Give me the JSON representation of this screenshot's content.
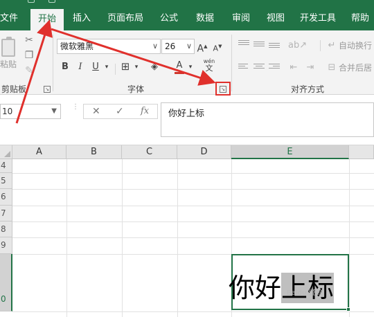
{
  "ribbon": {
    "tabs": [
      {
        "label": "文件"
      },
      {
        "label": "开始",
        "active": true
      },
      {
        "label": "插入"
      },
      {
        "label": "页面布局"
      },
      {
        "label": "公式"
      },
      {
        "label": "数据"
      },
      {
        "label": "审阅"
      },
      {
        "label": "视图"
      },
      {
        "label": "开发工具"
      },
      {
        "label": "帮助"
      }
    ],
    "clipboard": {
      "paste_label": "粘贴",
      "group_label": "剪贴板"
    },
    "font": {
      "font_name": "微软雅黑",
      "font_size": "26",
      "grow_label": "A",
      "shrink_label": "A",
      "bold_label": "B",
      "italic_label": "I",
      "underline_label": "U",
      "font_color_label": "A",
      "phonetic_label": "wén",
      "group_label": "字体"
    },
    "alignment": {
      "wrap_text_label": "自动换行",
      "merge_center_label": "合并后居",
      "group_label": "对齐方式"
    }
  },
  "formula_bar": {
    "name_box": "10",
    "cancel_symbol": "✕",
    "enter_symbol": "✓",
    "fx_symbol": "fx",
    "content": "你好上标"
  },
  "sheet": {
    "columns": [
      "A",
      "B",
      "C",
      "D",
      "E"
    ],
    "rows": [
      "4",
      "5",
      "6",
      "7",
      "8",
      "9",
      "0"
    ],
    "selected_column": "E",
    "active_cell_text_plain": "你好",
    "active_cell_text_selected": "上标",
    "watermark": "Baidu 经验"
  },
  "colors": {
    "excel_green": "#217346",
    "annotation_red": "#e0302c"
  }
}
